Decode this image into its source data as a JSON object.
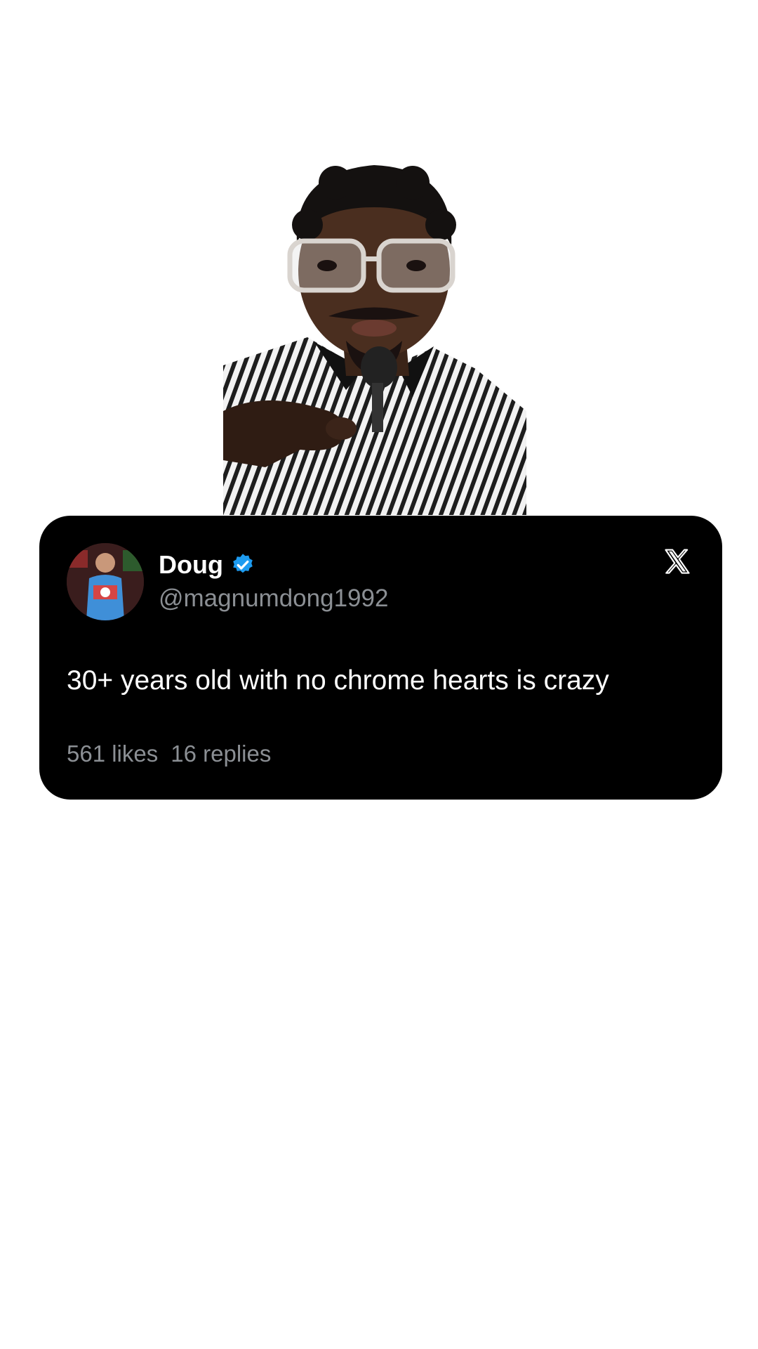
{
  "tweet": {
    "display_name": "Doug",
    "handle": "@magnumdong1992",
    "text": "30+ years old with no chrome hearts is crazy",
    "likes": "561 likes",
    "replies": "16 replies",
    "verified": true
  },
  "icons": {
    "verified": "verified-badge-icon",
    "platform": "x-logo-icon"
  },
  "colors": {
    "card_background": "#000000",
    "page_background": "#ffffff",
    "verified_blue": "#1d9bf0",
    "secondary_text": "#8b8f94"
  }
}
